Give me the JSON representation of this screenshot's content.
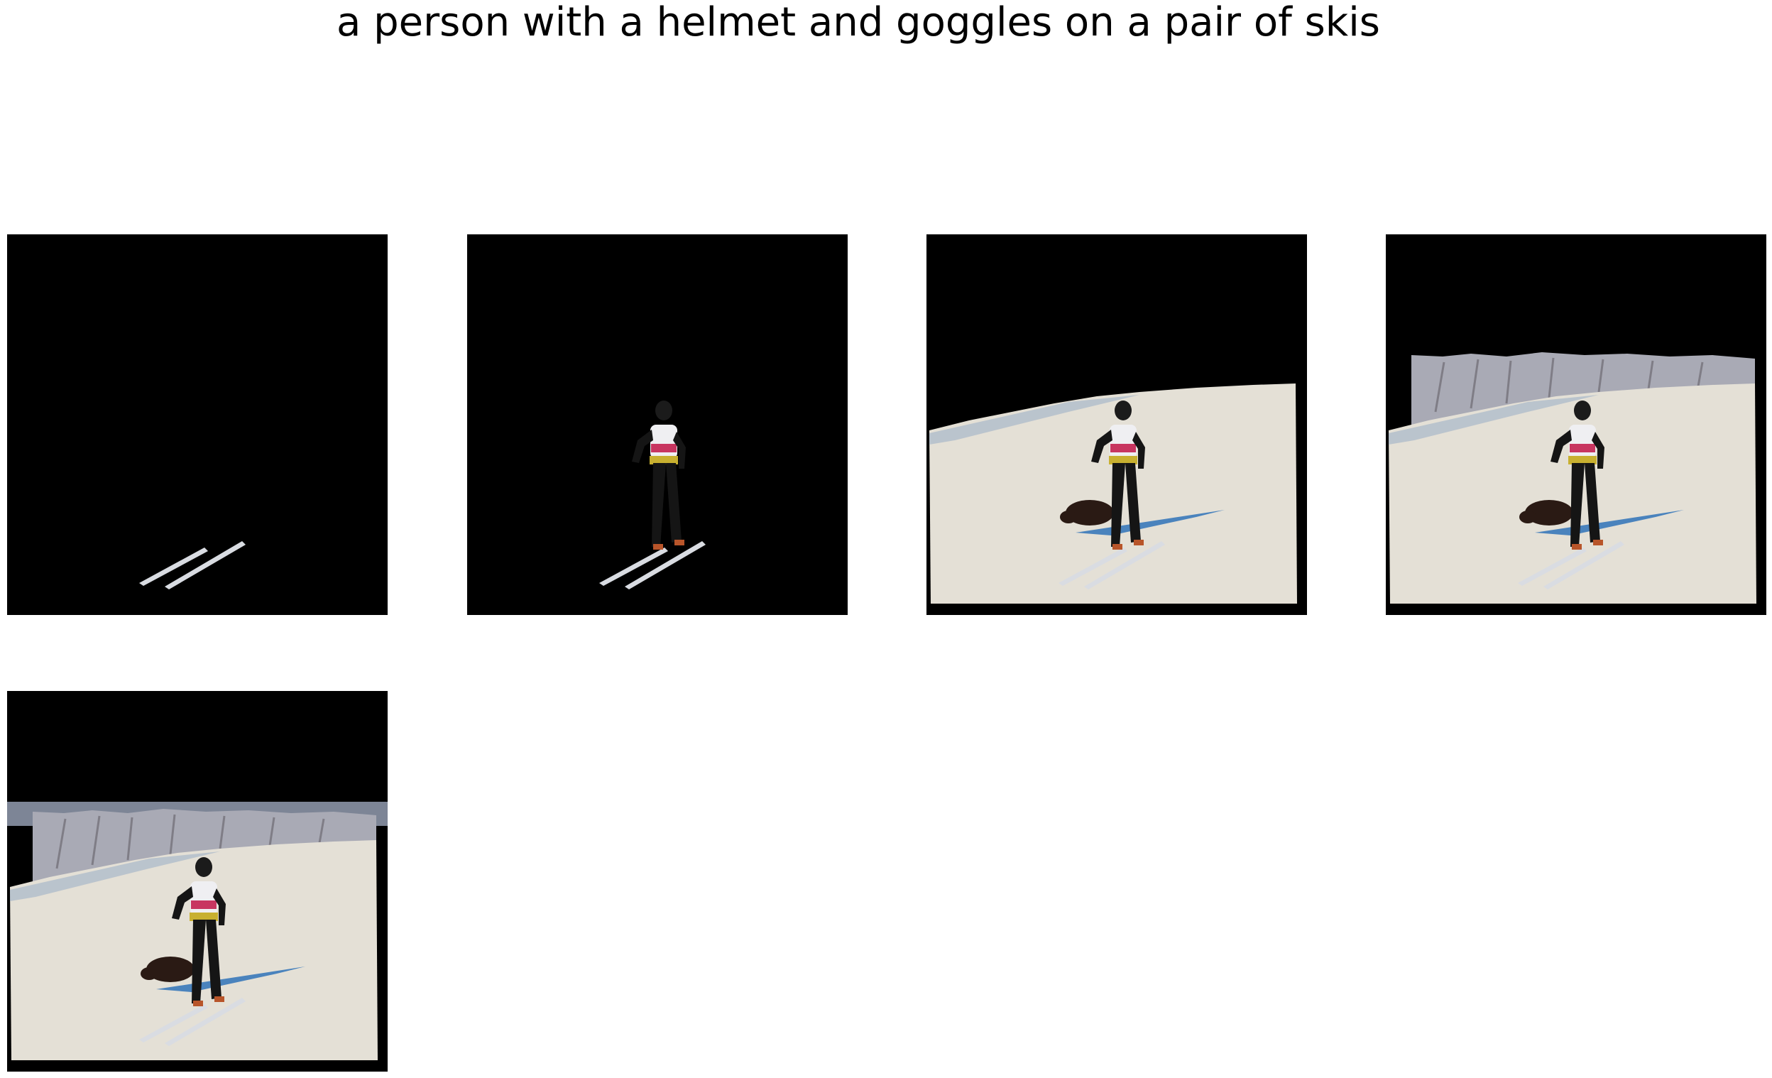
{
  "title": "a person with a helmet and goggles on a pair of skis",
  "panels": [
    {
      "name": "segment-skis",
      "content": [
        "skis"
      ]
    },
    {
      "name": "segment-skier",
      "content": [
        "skier",
        "skis"
      ]
    },
    {
      "name": "segment-skier-dog-snow",
      "content": [
        "skier",
        "skis",
        "dog",
        "snow slope"
      ]
    },
    {
      "name": "segment-skier-dog-snow-trees",
      "content": [
        "skier",
        "skis",
        "dog",
        "snow slope",
        "trees"
      ]
    },
    {
      "name": "segment-full-scene",
      "content": [
        "skier",
        "skis",
        "dog",
        "snow slope",
        "trees",
        "sky"
      ]
    }
  ],
  "colors": {
    "background": "#ffffff",
    "mask": "#000000",
    "snow": "#e4e0d6",
    "sky": "#7d8596",
    "trees": "#a9aab5",
    "shadow": "#4a83bd"
  }
}
